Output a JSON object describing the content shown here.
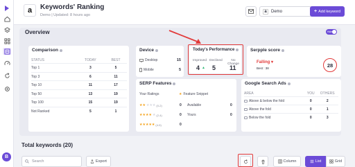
{
  "colors": {
    "accent": "#6b4bd7",
    "danger": "#e23b3b",
    "star": "#f4a21a"
  },
  "header": {
    "title": "Keywords' Ranking",
    "subtitle": "Demo | Updated: 8 hours ago",
    "site_select": "Demo",
    "add_keyword": "Add keyword"
  },
  "overview": {
    "title": "Overview",
    "toggle_label": "Hide"
  },
  "comparison": {
    "title": "Comparison",
    "columns": [
      "STATUS",
      "TODAY",
      "BEST"
    ],
    "rows": [
      {
        "status": "Top 1",
        "today": "3",
        "best": "5"
      },
      {
        "status": "Top 3",
        "today": "6",
        "best": "11"
      },
      {
        "status": "Top 10",
        "today": "11",
        "best": "17"
      },
      {
        "status": "Top 50",
        "today": "13",
        "best": "19"
      },
      {
        "status": "Top 100",
        "today": "15",
        "best": "19"
      },
      {
        "status": "Not Ranked",
        "today": "5",
        "best": "1"
      }
    ]
  },
  "device": {
    "title": "Device",
    "items": [
      {
        "label": "Desktop",
        "value": "15",
        "icon": "desktop-icon"
      },
      {
        "label": "Mobile",
        "value": "5",
        "icon": "mobile-icon"
      }
    ]
  },
  "performance": {
    "title": "Today's Performance",
    "cols": [
      {
        "label": "Improved",
        "value": "4"
      },
      {
        "label": "Declined",
        "value": "5"
      },
      {
        "label": "No Change",
        "value": "11"
      }
    ]
  },
  "serpple_score": {
    "title": "Serpple score",
    "trend": "Falling",
    "best": "Best : 38",
    "score": "28"
  },
  "serp_features": {
    "title": "SERP Features",
    "your_ratings": "Your Ratings",
    "feature_snippet": "Feature Snippet",
    "ratings": [
      {
        "stars": 2,
        "range": "(0-2)",
        "value": "0"
      },
      {
        "stars": 4,
        "range": "(2-4)",
        "value": "0"
      },
      {
        "stars": 5,
        "range": "(4-5)",
        "value": "0"
      }
    ],
    "snippet_rows": [
      {
        "label": "Available",
        "value": "0"
      },
      {
        "label": "Yours",
        "value": "0"
      }
    ]
  },
  "google_ads": {
    "title": "Google Search Ads",
    "columns": [
      "AREA",
      "YOU",
      "OTHERS"
    ],
    "rows": [
      {
        "area": "Above & below the fold",
        "you": "0",
        "others": "2"
      },
      {
        "area": "Above the fold",
        "you": "0",
        "others": "1"
      },
      {
        "area": "Below the fold",
        "you": "0",
        "others": "3"
      }
    ]
  },
  "keywords": {
    "total": "Total keywords (20)",
    "search_placeholder": "Search",
    "export": "Export",
    "column": "Column",
    "list": "List",
    "grid": "Grid"
  }
}
